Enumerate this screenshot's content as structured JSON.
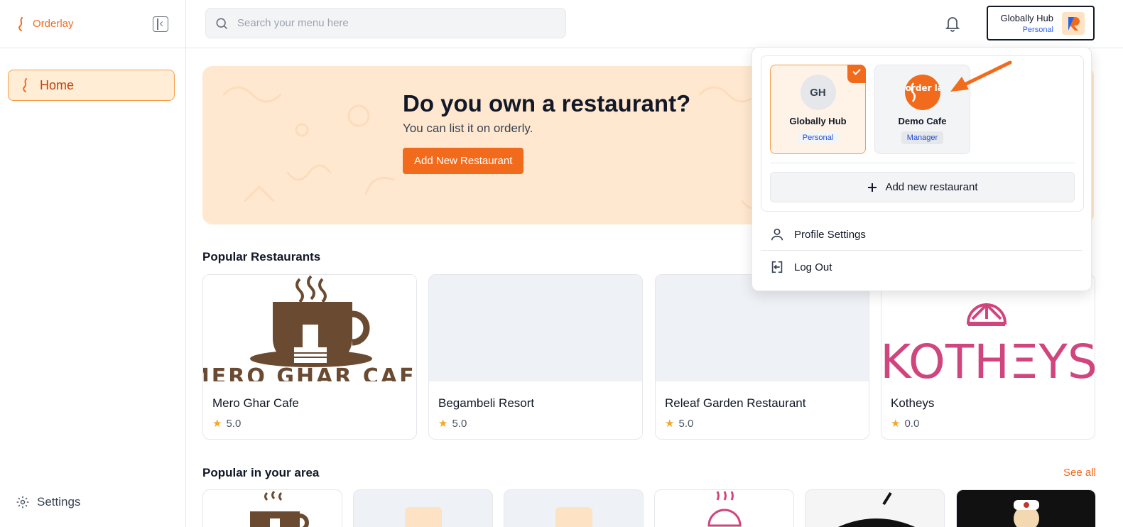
{
  "app": {
    "brand": "Orderlay"
  },
  "sidebar": {
    "home_label": "Home",
    "settings_label": "Settings"
  },
  "search": {
    "placeholder": "Search your menu here",
    "value": ""
  },
  "account": {
    "name": "Globally Hub",
    "role": "Personal"
  },
  "banner": {
    "title": "Do you own a restaurant?",
    "subtitle": "You can list it on orderly.",
    "button": "Add New Restaurant"
  },
  "popular": {
    "title": "Popular Restaurants",
    "items": [
      {
        "name": "Mero Ghar Cafe",
        "rating": "5.0",
        "logo_text": "MERO GHAR CAFE"
      },
      {
        "name": "Begambeli Resort",
        "rating": "5.0"
      },
      {
        "name": "Releaf Garden Restaurant",
        "rating": "5.0"
      },
      {
        "name": "Kotheys",
        "rating": "0.0",
        "logo_text": "KOTHΞYS"
      }
    ]
  },
  "area": {
    "title": "Popular in your area",
    "see_all": "See all"
  },
  "dropdown": {
    "restaurants": [
      {
        "initials": "GH",
        "name": "Globally Hub",
        "role": "Personal",
        "selected": true
      },
      {
        "logo_text": "order lay",
        "name": "Demo Cafe",
        "role": "Manager",
        "selected": false
      }
    ],
    "add_new": "Add new restaurant",
    "profile_settings": "Profile Settings",
    "logout": "Log Out"
  },
  "colors": {
    "accent": "#f26b1d",
    "banner_bg": "#ffe8cf",
    "role_text": "#1d4ed8"
  }
}
